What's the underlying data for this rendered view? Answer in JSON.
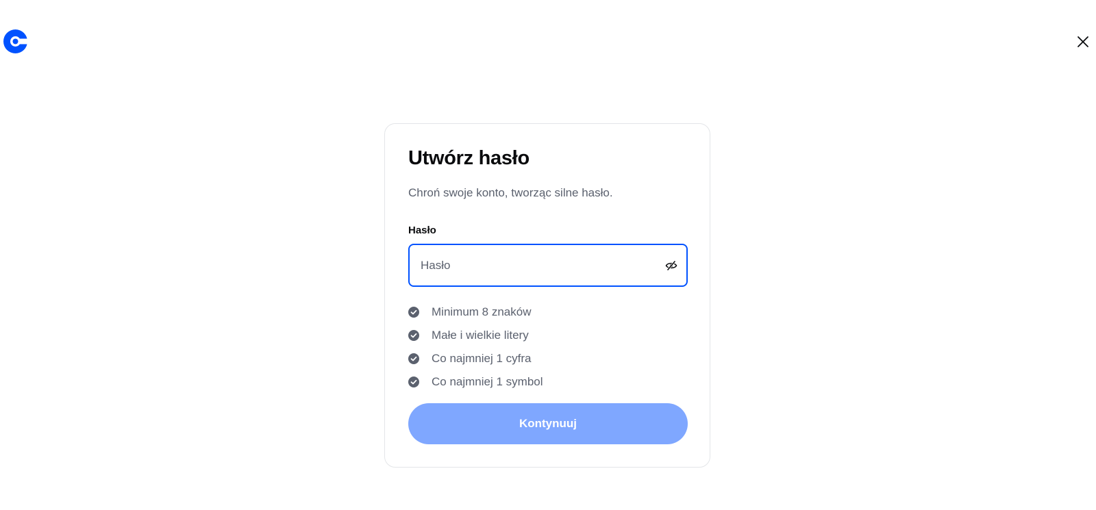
{
  "header": {
    "logo_icon": "coinbase-logo-icon",
    "close_icon": "close-icon"
  },
  "card": {
    "title": "Utwórz hasło",
    "subtitle": "Chroń swoje konto, tworząc silne hasło.",
    "password_field": {
      "label": "Hasło",
      "placeholder": "Hasło",
      "value": "",
      "toggle_icon": "eye-slash-icon"
    },
    "requirements": [
      {
        "label": "Minimum 8 znaków",
        "icon": "check-circle-icon"
      },
      {
        "label": "Małe i wielkie litery",
        "icon": "check-circle-icon"
      },
      {
        "label": "Co najmniej 1 cyfra",
        "icon": "check-circle-icon"
      },
      {
        "label": "Co najmniej 1 symbol",
        "icon": "check-circle-icon"
      }
    ],
    "continue_label": "Kontynuuj"
  },
  "colors": {
    "brand": "#0052ff",
    "button_disabled": "#7fa7ff",
    "muted_text": "#5b616e",
    "check_icon": "#5b616e"
  }
}
